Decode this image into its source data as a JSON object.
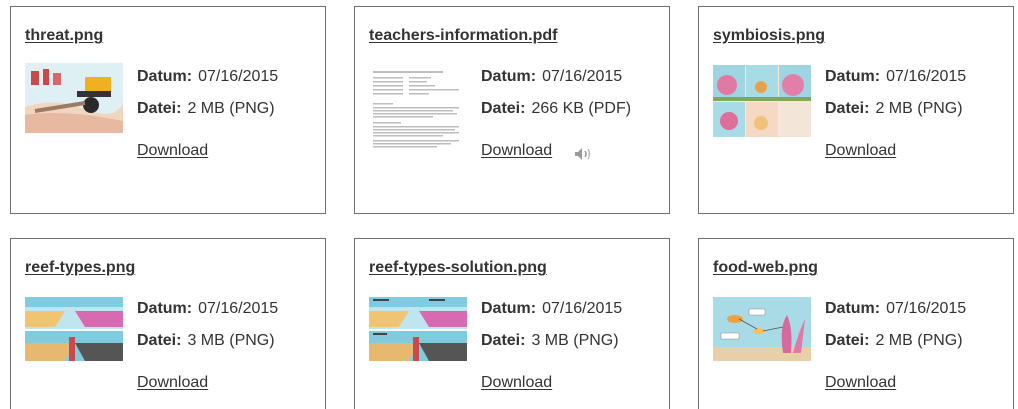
{
  "labels": {
    "date": "Datum:",
    "file": "Datei:",
    "download": "Download"
  },
  "files": [
    {
      "name": "threat.png",
      "date": "07/16/2015",
      "size": "2 MB (PNG)",
      "thumb": "threat-thumbnail"
    },
    {
      "name": "teachers-information.pdf",
      "date": "07/16/2015",
      "size": "266 KB (PDF)",
      "thumb": "document-thumbnail",
      "audio_icon": "speaker-icon"
    },
    {
      "name": "symbiosis.png",
      "date": "07/16/2015",
      "size": "2 MB (PNG)",
      "thumb": "symbiosis-thumbnail"
    },
    {
      "name": "reef-types.png",
      "date": "07/16/2015",
      "size": "3 MB (PNG)",
      "thumb": "reef-types-thumbnail"
    },
    {
      "name": "reef-types-solution.png",
      "date": "07/16/2015",
      "size": "3 MB (PNG)",
      "thumb": "reef-types-solution-thumbnail"
    },
    {
      "name": "food-web.png",
      "date": "07/16/2015",
      "size": "2 MB (PNG)",
      "thumb": "food-web-thumbnail"
    }
  ],
  "colors": {
    "border": "#6f6f6f",
    "text": "#333333",
    "background": "#ffffff"
  }
}
